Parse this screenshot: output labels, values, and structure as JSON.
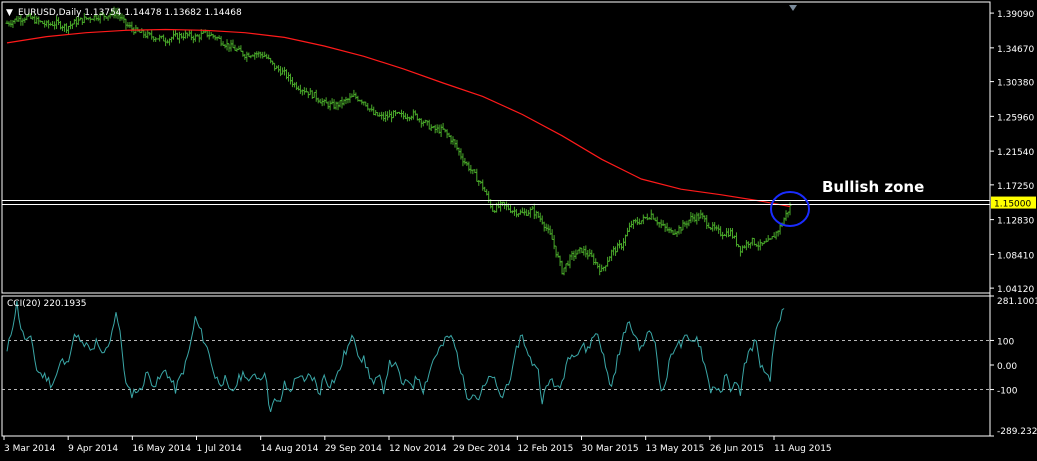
{
  "symbol_header": {
    "marker": "▼",
    "text": "EURUSD,Daily  1.13754 1.14478 1.13682 1.14468"
  },
  "cci_header": {
    "text": "CCI(20) 220.1935"
  },
  "annotation": {
    "text": "Bullish zone"
  },
  "colors": {
    "background": "#000000",
    "price_bars": "#49a82a",
    "moving_average": "#ff1a1a",
    "cci_line": "#3aa6a6",
    "level_line": "#ffffff",
    "circle": "#1a2cff",
    "price_tag_bg": "#ffff00",
    "axis_text": "#ffffff"
  },
  "chart_data": [
    {
      "type": "line",
      "title": "EURUSD,Daily",
      "y_ticks": [
        "1.39090",
        "1.34670",
        "1.30380",
        "1.25960",
        "1.21540",
        "1.17250",
        "1.12830",
        "1.08410",
        "1.04120"
      ],
      "ylim": [
        1.035,
        1.405
      ],
      "x_ticks": [
        "3 Mar 2014",
        "9 Apr 2014",
        "16 May 2014",
        "1 Jul 2014",
        "14 Aug 2014",
        "29 Sep 2014",
        "12 Nov 2014",
        "29 Dec 2014",
        "12 Feb 2015",
        "30 Mar 2015",
        "13 May 2015",
        "26 Jun 2015",
        "11 Aug 2015"
      ],
      "horizontal_line": {
        "value": 1.15,
        "label": "1.15000"
      },
      "series": [
        {
          "style": "bars",
          "points": [
            [
              0,
              1.378
            ],
            [
              10,
              1.383
            ],
            [
              20,
              1.386
            ],
            [
              30,
              1.381
            ],
            [
              40,
              1.376
            ],
            [
              50,
              1.378
            ],
            [
              60,
              1.373
            ],
            [
              70,
              1.38
            ],
            [
              80,
              1.384
            ],
            [
              90,
              1.387
            ],
            [
              100,
              1.388
            ],
            [
              110,
              1.392
            ],
            [
              120,
              1.376
            ],
            [
              130,
              1.368
            ],
            [
              140,
              1.363
            ],
            [
              150,
              1.36
            ],
            [
              160,
              1.357
            ],
            [
              170,
              1.361
            ],
            [
              180,
              1.363
            ],
            [
              190,
              1.36
            ],
            [
              200,
              1.365
            ],
            [
              210,
              1.361
            ],
            [
              220,
              1.352
            ],
            [
              230,
              1.345
            ],
            [
              240,
              1.338
            ],
            [
              250,
              1.34
            ],
            [
              260,
              1.337
            ],
            [
              270,
              1.322
            ],
            [
              280,
              1.314
            ],
            [
              290,
              1.3
            ],
            [
              300,
              1.293
            ],
            [
              310,
              1.286
            ],
            [
              320,
              1.276
            ],
            [
              330,
              1.273
            ],
            [
              340,
              1.278
            ],
            [
              350,
              1.285
            ],
            [
              360,
              1.279
            ],
            [
              370,
              1.262
            ],
            [
              380,
              1.258
            ],
            [
              390,
              1.262
            ],
            [
              400,
              1.26
            ],
            [
              410,
              1.262
            ],
            [
              420,
              1.253
            ],
            [
              430,
              1.243
            ],
            [
              440,
              1.242
            ],
            [
              450,
              1.228
            ],
            [
              460,
              1.205
            ],
            [
              470,
              1.188
            ],
            [
              480,
              1.17
            ],
            [
              490,
              1.141
            ],
            [
              500,
              1.147
            ],
            [
              510,
              1.14
            ],
            [
              520,
              1.136
            ],
            [
              530,
              1.14
            ],
            [
              540,
              1.127
            ],
            [
              550,
              1.103
            ],
            [
              560,
              1.063
            ],
            [
              570,
              1.082
            ],
            [
              580,
              1.09
            ],
            [
              590,
              1.08
            ],
            [
              600,
              1.063
            ],
            [
              610,
              1.087
            ],
            [
              620,
              1.096
            ],
            [
              630,
              1.123
            ],
            [
              640,
              1.127
            ],
            [
              650,
              1.135
            ],
            [
              660,
              1.121
            ],
            [
              670,
              1.112
            ],
            [
              680,
              1.118
            ],
            [
              690,
              1.13
            ],
            [
              700,
              1.133
            ],
            [
              710,
              1.119
            ],
            [
              720,
              1.111
            ],
            [
              730,
              1.112
            ],
            [
              740,
              1.091
            ],
            [
              750,
              1.102
            ],
            [
              760,
              1.095
            ],
            [
              770,
              1.101
            ],
            [
              780,
              1.119
            ],
            [
              790,
              1.145
            ]
          ]
        },
        {
          "style": "line",
          "points": [
            [
              0,
              1.353
            ],
            [
              40,
              1.361
            ],
            [
              80,
              1.366
            ],
            [
              120,
              1.369
            ],
            [
              160,
              1.37
            ],
            [
              200,
              1.369
            ],
            [
              240,
              1.366
            ],
            [
              280,
              1.36
            ],
            [
              320,
              1.349
            ],
            [
              360,
              1.336
            ],
            [
              400,
              1.32
            ],
            [
              440,
              1.302
            ],
            [
              480,
              1.285
            ],
            [
              520,
              1.262
            ],
            [
              560,
              1.235
            ],
            [
              600,
              1.205
            ],
            [
              640,
              1.18
            ],
            [
              680,
              1.167
            ],
            [
              720,
              1.16
            ],
            [
              760,
              1.152
            ],
            [
              790,
              1.145
            ]
          ]
        }
      ]
    },
    {
      "type": "line",
      "title": "CCI(20) 220.1935",
      "y_ticks": [
        "281.1001",
        "100",
        "0.00",
        "-100",
        "-289.2322"
      ],
      "ylim": [
        -289.2322,
        281.1001
      ],
      "levels": [
        100,
        -100
      ],
      "series": [
        {
          "style": "line",
          "points": [
            [
              0,
              50
            ],
            [
              5,
              150
            ],
            [
              10,
              250
            ],
            [
              15,
              130
            ],
            [
              20,
              100
            ],
            [
              25,
              100
            ],
            [
              30,
              -20
            ],
            [
              35,
              -40
            ],
            [
              40,
              -50
            ],
            [
              45,
              -80
            ],
            [
              50,
              -40
            ],
            [
              55,
              20
            ],
            [
              60,
              0
            ],
            [
              65,
              80
            ],
            [
              70,
              130
            ],
            [
              75,
              80
            ],
            [
              80,
              80
            ],
            [
              85,
              50
            ],
            [
              90,
              90
            ],
            [
              95,
              40
            ],
            [
              100,
              60
            ],
            [
              105,
              120
            ],
            [
              110,
              220
            ],
            [
              115,
              100
            ],
            [
              120,
              -80
            ],
            [
              125,
              -120
            ],
            [
              130,
              -100
            ],
            [
              135,
              -110
            ],
            [
              140,
              -30
            ],
            [
              145,
              -60
            ],
            [
              150,
              -80
            ],
            [
              155,
              -50
            ],
            [
              160,
              -20
            ],
            [
              165,
              -60
            ],
            [
              170,
              -100
            ],
            [
              175,
              -50
            ],
            [
              180,
              0
            ],
            [
              185,
              80
            ],
            [
              190,
              190
            ],
            [
              195,
              140
            ],
            [
              200,
              90
            ],
            [
              205,
              30
            ],
            [
              210,
              -50
            ],
            [
              215,
              -70
            ],
            [
              220,
              -60
            ],
            [
              225,
              -120
            ],
            [
              230,
              -90
            ],
            [
              235,
              -50
            ],
            [
              240,
              -30
            ],
            [
              245,
              -80
            ],
            [
              250,
              -30
            ],
            [
              255,
              -60
            ],
            [
              260,
              -20
            ],
            [
              265,
              -180
            ],
            [
              270,
              -150
            ],
            [
              275,
              -160
            ],
            [
              280,
              -80
            ],
            [
              285,
              -110
            ],
            [
              290,
              -70
            ],
            [
              295,
              -30
            ],
            [
              300,
              -80
            ],
            [
              305,
              -40
            ],
            [
              310,
              -60
            ],
            [
              315,
              -120
            ],
            [
              320,
              -40
            ],
            [
              325,
              -80
            ],
            [
              330,
              -60
            ],
            [
              335,
              -30
            ],
            [
              340,
              40
            ],
            [
              345,
              80
            ],
            [
              350,
              120
            ],
            [
              355,
              40
            ],
            [
              360,
              20
            ],
            [
              365,
              -30
            ],
            [
              370,
              -80
            ],
            [
              375,
              -50
            ],
            [
              380,
              -100
            ],
            [
              385,
              0
            ],
            [
              390,
              10
            ],
            [
              395,
              -30
            ],
            [
              400,
              -90
            ],
            [
              405,
              -60
            ],
            [
              410,
              -80
            ],
            [
              415,
              -40
            ],
            [
              420,
              -100
            ],
            [
              425,
              -40
            ],
            [
              430,
              20
            ],
            [
              435,
              60
            ],
            [
              440,
              80
            ],
            [
              445,
              120
            ],
            [
              450,
              100
            ],
            [
              455,
              30
            ],
            [
              460,
              -60
            ],
            [
              465,
              -130
            ],
            [
              470,
              -110
            ],
            [
              475,
              -140
            ],
            [
              480,
              -100
            ],
            [
              485,
              -70
            ],
            [
              490,
              -40
            ],
            [
              495,
              -110
            ],
            [
              500,
              -130
            ],
            [
              505,
              -70
            ],
            [
              510,
              -30
            ],
            [
              515,
              80
            ],
            [
              520,
              130
            ],
            [
              525,
              40
            ],
            [
              530,
              10
            ],
            [
              535,
              0
            ],
            [
              540,
              -140
            ],
            [
              545,
              -90
            ],
            [
              550,
              -50
            ],
            [
              555,
              -110
            ],
            [
              560,
              -70
            ],
            [
              565,
              20
            ],
            [
              570,
              60
            ],
            [
              575,
              40
            ],
            [
              580,
              80
            ],
            [
              585,
              60
            ],
            [
              590,
              100
            ],
            [
              595,
              140
            ],
            [
              600,
              70
            ],
            [
              605,
              -30
            ],
            [
              610,
              -90
            ],
            [
              615,
              10
            ],
            [
              620,
              80
            ],
            [
              625,
              170
            ],
            [
              630,
              150
            ],
            [
              635,
              110
            ],
            [
              640,
              60
            ],
            [
              645,
              120
            ],
            [
              650,
              130
            ],
            [
              655,
              80
            ],
            [
              660,
              -120
            ],
            [
              665,
              -60
            ],
            [
              670,
              40
            ],
            [
              675,
              90
            ],
            [
              680,
              80
            ],
            [
              685,
              110
            ],
            [
              690,
              90
            ],
            [
              695,
              120
            ],
            [
              700,
              70
            ],
            [
              705,
              -20
            ],
            [
              710,
              -100
            ],
            [
              715,
              -80
            ],
            [
              720,
              -130
            ],
            [
              725,
              -40
            ],
            [
              730,
              -90
            ],
            [
              735,
              -80
            ],
            [
              740,
              -110
            ],
            [
              745,
              20
            ],
            [
              750,
              60
            ],
            [
              755,
              100
            ],
            [
              760,
              10
            ],
            [
              765,
              -50
            ],
            [
              770,
              -60
            ],
            [
              775,
              130
            ],
            [
              780,
              200
            ],
            [
              785,
              220
            ]
          ]
        }
      ]
    }
  ]
}
